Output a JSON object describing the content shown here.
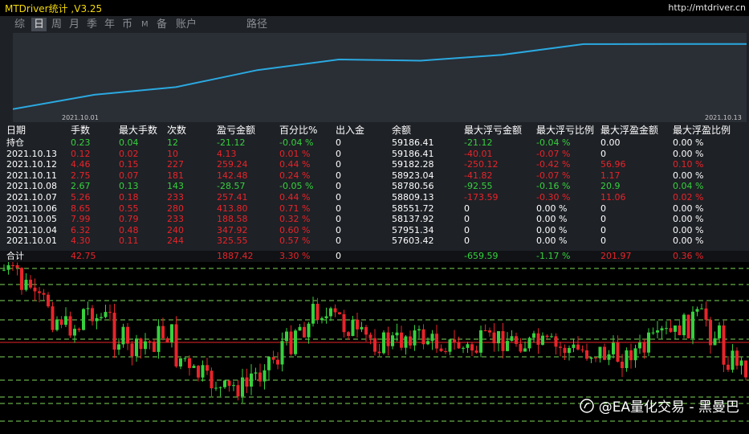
{
  "app_title": "MTDriver统计 ,V3.25",
  "site_url": "http://mtdriver.cn",
  "tabs": [
    "综",
    "日",
    "周",
    "月",
    "季",
    "年",
    "币",
    "M",
    "备",
    "账户",
    "路径"
  ],
  "active_tab": "日",
  "equity_chart": {
    "x_start_label": "2021.10.01",
    "x_end_label": "2021.10.13",
    "line_color": "#2aa9e0",
    "values": [
      57603.42,
      57951.34,
      58137.92,
      58551.72,
      58809.13,
      58780.56,
      58923.04,
      59182.28,
      59186.41,
      59186.41
    ]
  },
  "table": {
    "columns": [
      "日期",
      "手数",
      "最大手数",
      "次数",
      "盈亏金额",
      "百分比%",
      "出入金",
      "余额",
      "最大浮亏金额",
      "最大浮亏比例",
      "最大浮盈金额",
      "最大浮盈比例"
    ],
    "rows": [
      {
        "tone": "g",
        "cells": [
          "持仓",
          "0.23",
          "0.04",
          "12",
          "-21.12",
          "-0.04 %",
          "0",
          "59186.41",
          "-21.12",
          "-0.04 %",
          "0.00",
          "0.00 %"
        ]
      },
      {
        "tone": "r",
        "cells": [
          "2021.10.13",
          "0.12",
          "0.02",
          "10",
          "4.13",
          "0.01 %",
          "0",
          "59186.41",
          "-40.01",
          "-0.07 %",
          "0",
          "0.00 %"
        ]
      },
      {
        "tone": "r",
        "cells": [
          "2021.10.12",
          "4.46",
          "0.15",
          "227",
          "259.24",
          "0.44 %",
          "0",
          "59182.28",
          "-250.12",
          "-0.42 %",
          "56.96",
          "0.10 %"
        ]
      },
      {
        "tone": "r",
        "cells": [
          "2021.10.11",
          "2.75",
          "0.07",
          "181",
          "142.48",
          "0.24 %",
          "0",
          "58923.04",
          "-41.82",
          "-0.07 %",
          "1.17",
          "0.00 %"
        ]
      },
      {
        "tone": "g",
        "cells": [
          "2021.10.08",
          "2.67",
          "0.13",
          "143",
          "-28.57",
          "-0.05 %",
          "0",
          "58780.56",
          "-92.55",
          "-0.16 %",
          "20.9",
          "0.04 %"
        ]
      },
      {
        "tone": "r",
        "cells": [
          "2021.10.07",
          "5.26",
          "0.18",
          "233",
          "257.41",
          "0.44 %",
          "0",
          "58809.13",
          "-173.59",
          "-0.30 %",
          "11.06",
          "0.02 %"
        ]
      },
      {
        "tone": "r",
        "cells": [
          "2021.10.06",
          "8.65",
          "0.55",
          "280",
          "413.80",
          "0.71 %",
          "0",
          "58551.72",
          "0",
          "0.00 %",
          "0",
          "0.00 %"
        ]
      },
      {
        "tone": "r",
        "cells": [
          "2021.10.05",
          "7.99",
          "0.79",
          "233",
          "188.58",
          "0.32 %",
          "0",
          "58137.92",
          "0",
          "0.00 %",
          "0",
          "0.00 %"
        ]
      },
      {
        "tone": "r",
        "cells": [
          "2021.10.04",
          "6.32",
          "0.48",
          "240",
          "347.92",
          "0.60 %",
          "0",
          "57951.34",
          "0",
          "0.00 %",
          "0",
          "0.00 %"
        ]
      },
      {
        "tone": "r",
        "cells": [
          "2021.10.01",
          "4.30",
          "0.11",
          "244",
          "325.55",
          "0.57 %",
          "0",
          "57603.42",
          "0",
          "0.00 %",
          "0",
          "0.00 %"
        ]
      }
    ],
    "total": [
      "合计",
      "42.75",
      "",
      "",
      "1887.42",
      "3.30 %",
      "0",
      "",
      "-659.59",
      "-1.17 %",
      "201.97",
      "0.36 %"
    ],
    "colors": {
      "red": "#e8242a",
      "green": "#36d13e"
    }
  },
  "watermark": "@EA量化交易 - 黑曼巴"
}
